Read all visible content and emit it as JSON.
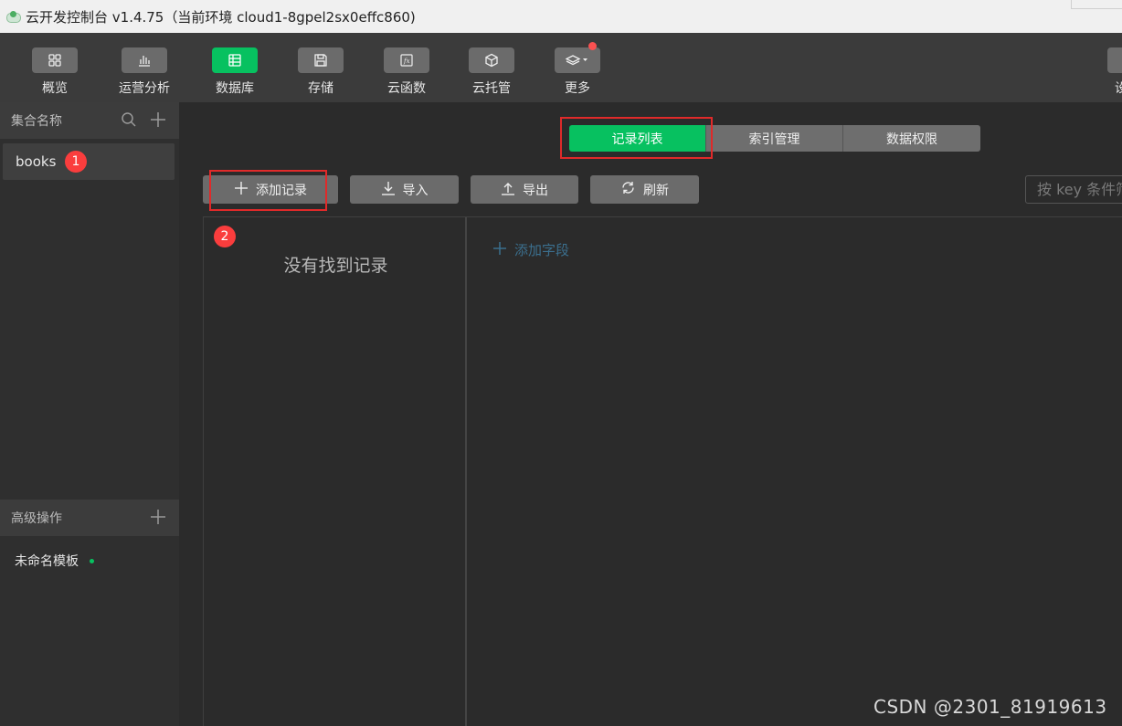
{
  "window": {
    "title": "云开发控制台 v1.4.75（当前环境 cloud1-8gpel2sx0effc860)"
  },
  "toolbar": {
    "items": [
      {
        "label": "概览",
        "icon": "grid-icon"
      },
      {
        "label": "运营分析",
        "icon": "bar-chart-icon"
      },
      {
        "label": "数据库",
        "icon": "database-icon"
      },
      {
        "label": "存储",
        "icon": "save-icon"
      },
      {
        "label": "云函数",
        "icon": "function-icon"
      },
      {
        "label": "云托管",
        "icon": "cube-icon"
      },
      {
        "label": "更多",
        "icon": "layers-icon"
      }
    ],
    "right_label": "设",
    "accent": "#07c160",
    "notify_color": "#fa5151"
  },
  "sidebar": {
    "collections_header": "集合名称",
    "collections": [
      {
        "name": "books"
      }
    ],
    "advanced_header": "高级操作",
    "templates": [
      {
        "name": "未命名模板"
      }
    ]
  },
  "annotations": {
    "badge1": "1",
    "badge2": "2",
    "highlight_color": "#e02a2a"
  },
  "main": {
    "tabs": [
      {
        "label": "记录列表",
        "active": true
      },
      {
        "label": "索引管理",
        "active": false
      },
      {
        "label": "数据权限",
        "active": false
      }
    ],
    "actions": {
      "add_record": "添加记录",
      "import": "导入",
      "export": "导出",
      "refresh": "刷新"
    },
    "search": {
      "placeholder": "按 key 条件筛"
    },
    "empty_text": "没有找到记录",
    "add_field": "添加字段"
  },
  "watermark": "CSDN @2301_81919613"
}
